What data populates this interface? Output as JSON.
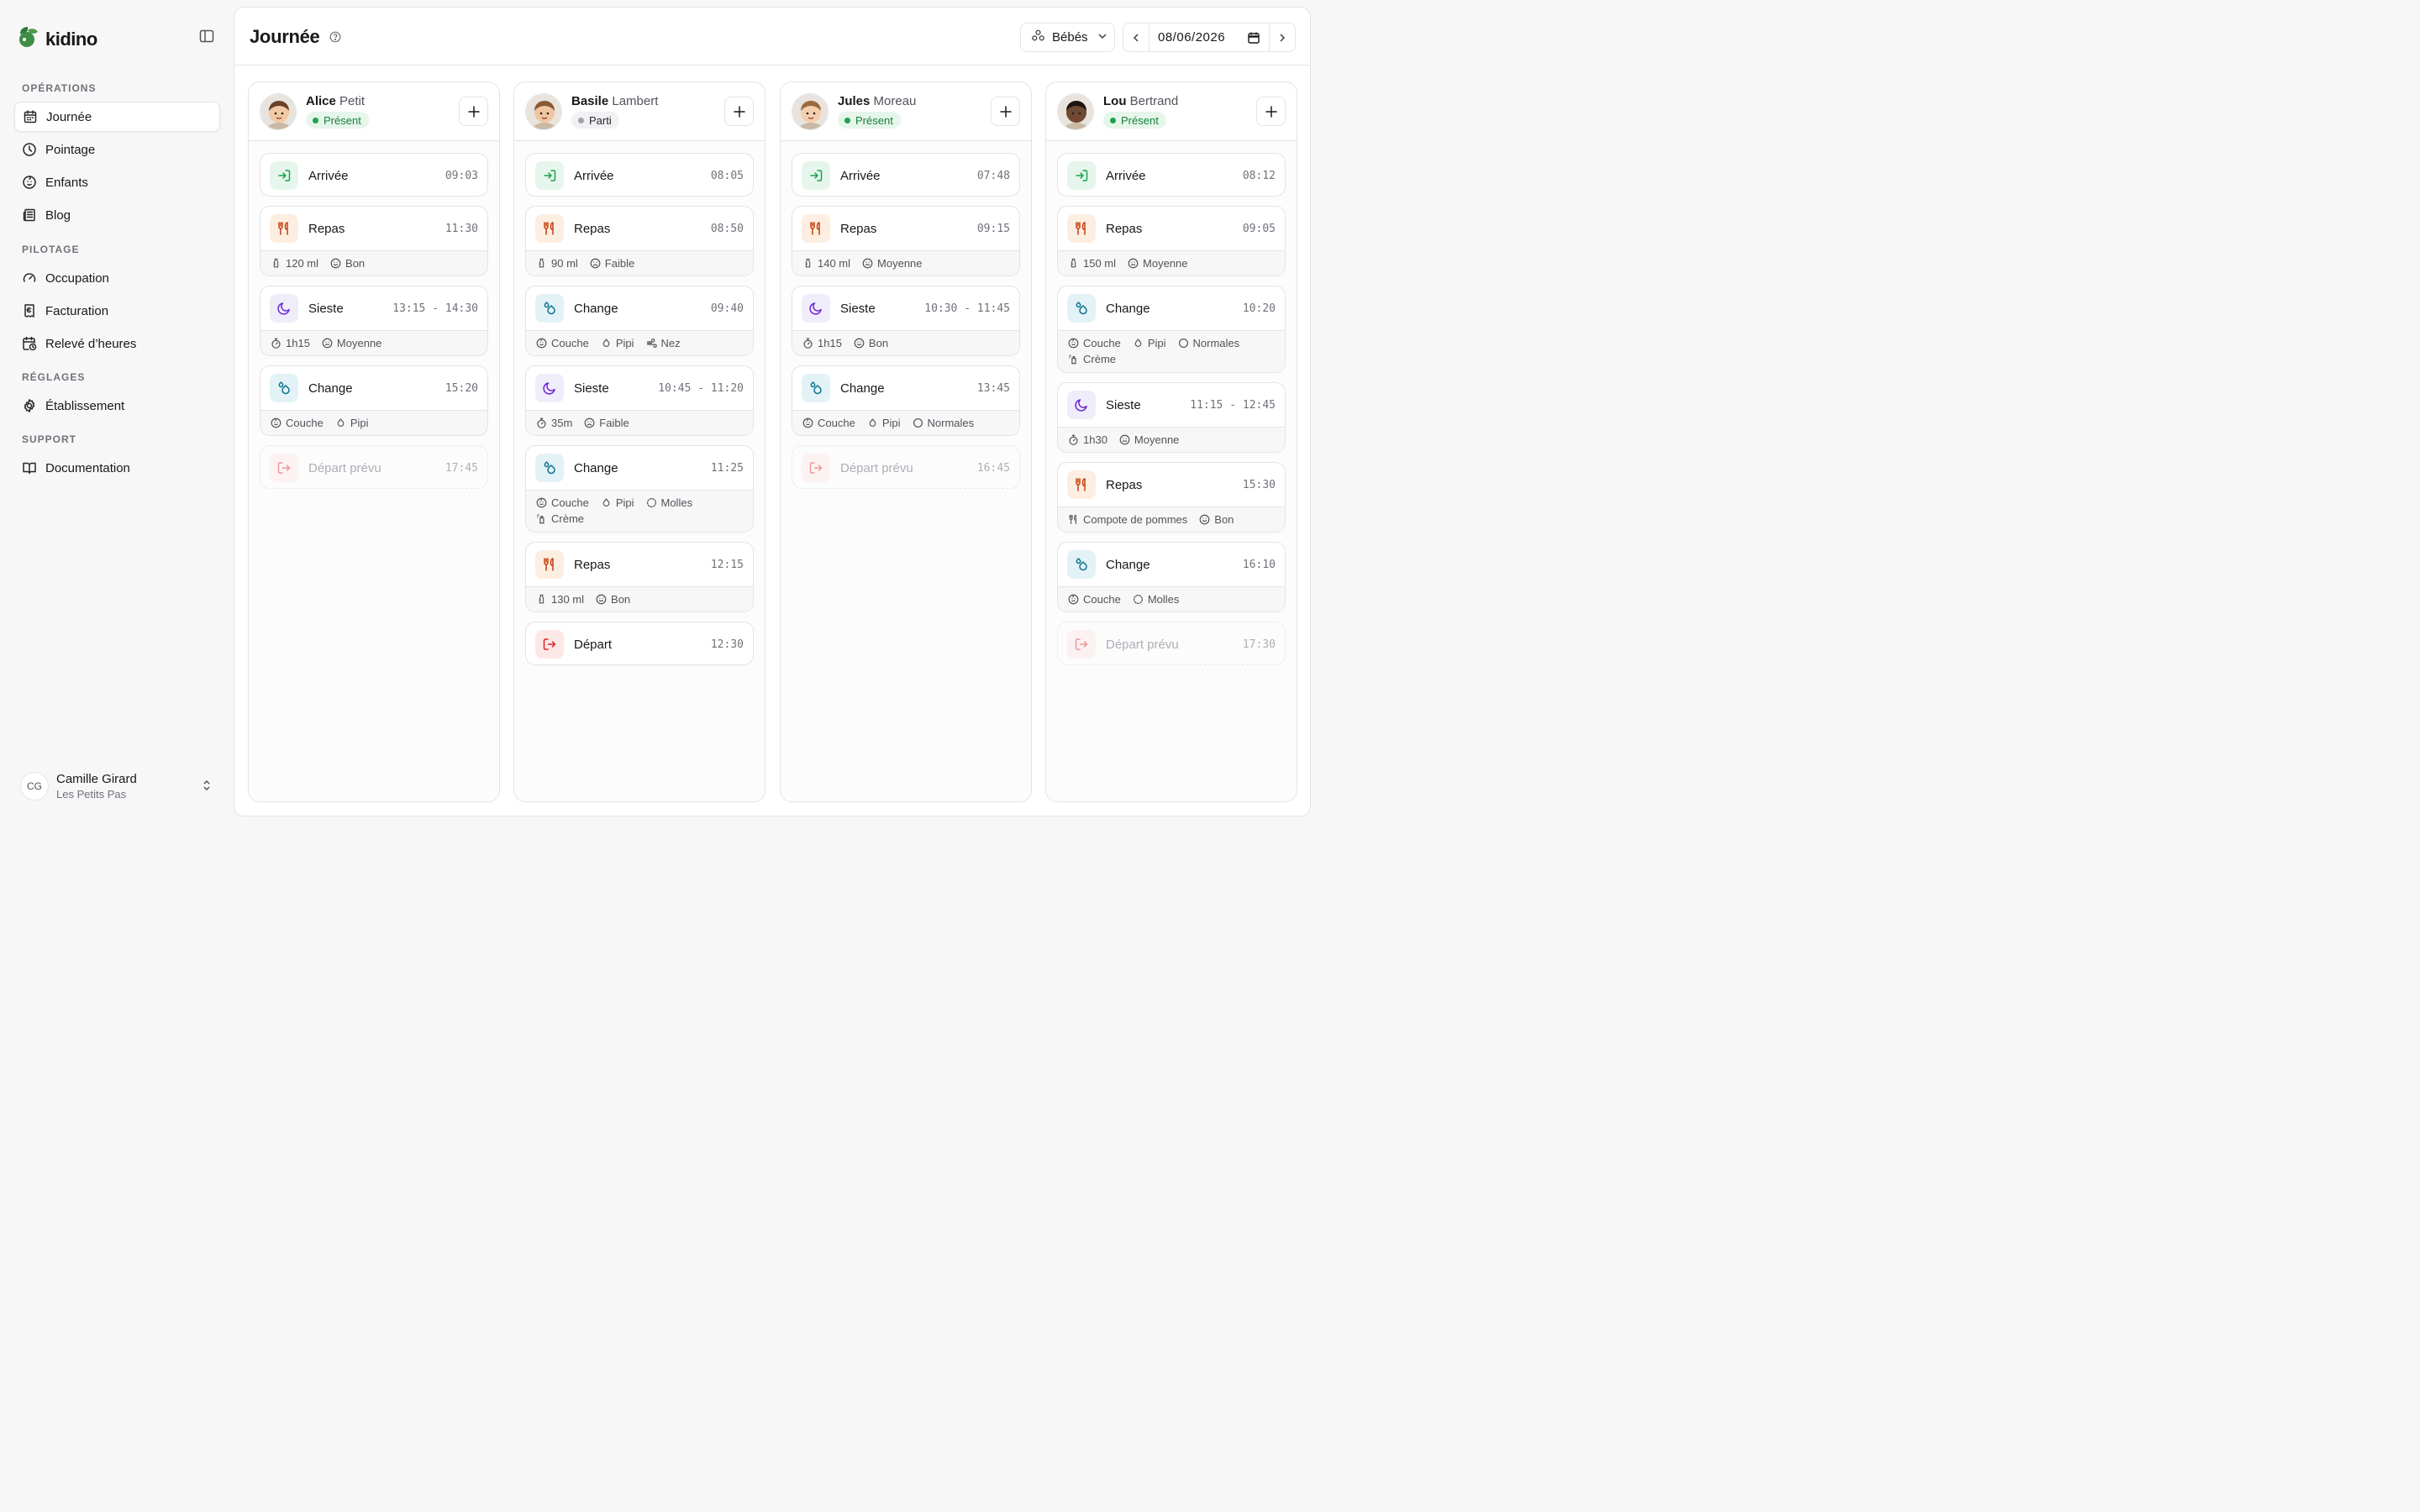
{
  "app": {
    "name": "kidino"
  },
  "sidebar": {
    "sections": [
      {
        "title": "OPÉRATIONS",
        "items": [
          {
            "label": "Journée",
            "icon": "calendar-icon",
            "active": true
          },
          {
            "label": "Pointage",
            "icon": "clock-icon"
          },
          {
            "label": "Enfants",
            "icon": "baby-icon"
          },
          {
            "label": "Blog",
            "icon": "newspaper-icon"
          }
        ]
      },
      {
        "title": "PILOTAGE",
        "items": [
          {
            "label": "Occupation",
            "icon": "gauge-icon"
          },
          {
            "label": "Facturation",
            "icon": "receipt-icon"
          },
          {
            "label": "Relevé d’heures",
            "icon": "calendar-clock-icon"
          }
        ]
      },
      {
        "title": "RÉGLAGES",
        "items": [
          {
            "label": "Établissement",
            "icon": "gear-icon"
          }
        ]
      },
      {
        "title": "SUPPORT",
        "items": [
          {
            "label": "Documentation",
            "icon": "book-icon"
          }
        ]
      }
    ],
    "user": {
      "initials": "CG",
      "name": "Camille Girard",
      "org": "Les Petits Pas"
    }
  },
  "header": {
    "title": "Journée",
    "group": "Bébés",
    "date": "08/06/2026"
  },
  "colors": {
    "green": "#16a34a",
    "orange": "#c2410c",
    "blue": "#0e7490",
    "purple": "#6d28d9",
    "red": "#dc2626"
  },
  "children": [
    {
      "first": "Alice",
      "last": "Petit",
      "status": "Présent",
      "status_kind": "present",
      "skin": "#f2c9a5",
      "hair": "#6b4028",
      "events": [
        {
          "type": "arrivee",
          "label": "Arrivée",
          "time": "09:03"
        },
        {
          "type": "repas",
          "label": "Repas",
          "time": "11:30",
          "details": [
            {
              "icon": "bottle-icon",
              "text": "120 ml"
            },
            {
              "icon": "smile-icon",
              "text": "Bon"
            }
          ]
        },
        {
          "type": "sieste",
          "label": "Sieste",
          "time": "13:15 - 14:30",
          "details": [
            {
              "icon": "timer-icon",
              "text": "1h15"
            },
            {
              "icon": "meh-icon",
              "text": "Moyenne"
            }
          ]
        },
        {
          "type": "change",
          "label": "Change",
          "time": "15:20",
          "details": [
            {
              "icon": "diaper-icon",
              "text": "Couche"
            },
            {
              "icon": "droplet-icon",
              "text": "Pipi"
            }
          ]
        },
        {
          "type": "depart",
          "label": "Départ prévu",
          "time": "17:45",
          "planned": true
        }
      ]
    },
    {
      "first": "Basile",
      "last": "Lambert",
      "status": "Parti",
      "status_kind": "gone",
      "skin": "#f0c6a2",
      "hair": "#8a5a34",
      "events": [
        {
          "type": "arrivee",
          "label": "Arrivée",
          "time": "08:05"
        },
        {
          "type": "repas",
          "label": "Repas",
          "time": "08:50",
          "details": [
            {
              "icon": "bottle-icon",
              "text": "90 ml"
            },
            {
              "icon": "frown-icon",
              "text": "Faible"
            }
          ]
        },
        {
          "type": "change",
          "label": "Change",
          "time": "09:40",
          "details": [
            {
              "icon": "diaper-icon",
              "text": "Couche"
            },
            {
              "icon": "droplet-icon",
              "text": "Pipi"
            },
            {
              "icon": "wind-icon",
              "text": "Nez"
            }
          ]
        },
        {
          "type": "sieste",
          "label": "Sieste",
          "time": "10:45 - 11:20",
          "details": [
            {
              "icon": "timer-icon",
              "text": "35m"
            },
            {
              "icon": "frown-icon",
              "text": "Faible"
            }
          ]
        },
        {
          "type": "change",
          "label": "Change",
          "time": "11:25",
          "details": [
            {
              "icon": "diaper-icon",
              "text": "Couche"
            },
            {
              "icon": "droplet-icon",
              "text": "Pipi"
            },
            {
              "icon": "dashed-circle-icon",
              "text": "Molles"
            },
            {
              "icon": "cream-icon",
              "text": "Crème"
            }
          ]
        },
        {
          "type": "repas",
          "label": "Repas",
          "time": "12:15",
          "details": [
            {
              "icon": "bottle-icon",
              "text": "130 ml"
            },
            {
              "icon": "smile-icon",
              "text": "Bon"
            }
          ]
        },
        {
          "type": "depart",
          "label": "Départ",
          "time": "12:30"
        }
      ]
    },
    {
      "first": "Jules",
      "last": "Moreau",
      "status": "Présent",
      "status_kind": "present",
      "skin": "#f3cfae",
      "hair": "#9b6a3f",
      "events": [
        {
          "type": "arrivee",
          "label": "Arrivée",
          "time": "07:48"
        },
        {
          "type": "repas",
          "label": "Repas",
          "time": "09:15",
          "details": [
            {
              "icon": "bottle-icon",
              "text": "140 ml"
            },
            {
              "icon": "meh-icon",
              "text": "Moyenne"
            }
          ]
        },
        {
          "type": "sieste",
          "label": "Sieste",
          "time": "10:30 - 11:45",
          "details": [
            {
              "icon": "timer-icon",
              "text": "1h15"
            },
            {
              "icon": "smile-icon",
              "text": "Bon"
            }
          ]
        },
        {
          "type": "change",
          "label": "Change",
          "time": "13:45",
          "details": [
            {
              "icon": "diaper-icon",
              "text": "Couche"
            },
            {
              "icon": "droplet-icon",
              "text": "Pipi"
            },
            {
              "icon": "circle-icon",
              "text": "Normales"
            }
          ]
        },
        {
          "type": "depart",
          "label": "Départ prévu",
          "time": "16:45",
          "planned": true
        }
      ]
    },
    {
      "first": "Lou",
      "last": "Bertrand",
      "status": "Présent",
      "status_kind": "present",
      "skin": "#6e4a32",
      "hair": "#1f1410",
      "events": [
        {
          "type": "arrivee",
          "label": "Arrivée",
          "time": "08:12"
        },
        {
          "type": "repas",
          "label": "Repas",
          "time": "09:05",
          "details": [
            {
              "icon": "bottle-icon",
              "text": "150 ml"
            },
            {
              "icon": "meh-icon",
              "text": "Moyenne"
            }
          ]
        },
        {
          "type": "change",
          "label": "Change",
          "time": "10:20",
          "details": [
            {
              "icon": "diaper-icon",
              "text": "Couche"
            },
            {
              "icon": "droplet-icon",
              "text": "Pipi"
            },
            {
              "icon": "circle-icon",
              "text": "Normales"
            },
            {
              "icon": "cream-icon",
              "text": "Crème"
            }
          ]
        },
        {
          "type": "sieste",
          "label": "Sieste",
          "time": "11:15 - 12:45",
          "details": [
            {
              "icon": "timer-icon",
              "text": "1h30"
            },
            {
              "icon": "meh-icon",
              "text": "Moyenne"
            }
          ]
        },
        {
          "type": "repas",
          "label": "Repas",
          "time": "15:30",
          "details": [
            {
              "icon": "utensils-icon",
              "text": "Compote de pommes"
            },
            {
              "icon": "smile-icon",
              "text": "Bon"
            }
          ]
        },
        {
          "type": "change",
          "label": "Change",
          "time": "16:10",
          "details": [
            {
              "icon": "diaper-icon",
              "text": "Couche"
            },
            {
              "icon": "dashed-circle-icon",
              "text": "Molles"
            }
          ]
        },
        {
          "type": "depart",
          "label": "Départ prévu",
          "time": "17:30",
          "planned": true
        }
      ]
    }
  ]
}
